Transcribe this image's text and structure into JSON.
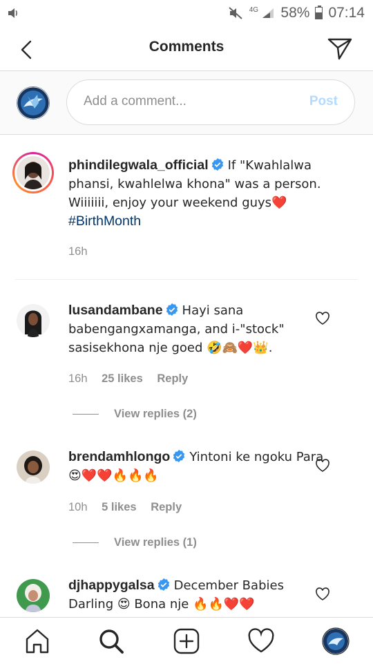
{
  "status_bar": {
    "network": "4G",
    "battery": "58%",
    "battery_level": 0.58,
    "time": "07:14"
  },
  "header": {
    "title": "Comments"
  },
  "composer": {
    "placeholder": "Add a comment...",
    "post_label": "Post"
  },
  "caption": {
    "username": "phindilegwala_official",
    "text": "If \"Kwahlalwa phansi, kwahlelwa khona\" was a person. Wiiiiiii, enjoy your weekend guys❤️",
    "hashtag": "#BirthMonth",
    "time": "16h"
  },
  "comments": [
    {
      "username": "lusandambane",
      "text": "Hayi sana babengangxamanga, and i-\"stock\" sasisekhona nje goed 🤣🙈❤️👑.",
      "time": "16h",
      "likes": "25 likes",
      "reply_label": "Reply",
      "view_replies": "View replies (2)"
    },
    {
      "username": "brendamhlongo",
      "text": "Yintoni ke ngoku Para 😍❤️❤️🔥🔥🔥",
      "time": "10h",
      "likes": "5 likes",
      "reply_label": "Reply",
      "view_replies": "View replies (1)"
    },
    {
      "username": "djhappygalsa",
      "text": "December Babies Darling 😍 Bona nje 🔥🔥❤️❤️"
    }
  ],
  "colors": {
    "verified": "#3897f0",
    "hashtag": "#003569",
    "muted": "#8e8e8e",
    "post_disabled": "#b3dbff"
  }
}
